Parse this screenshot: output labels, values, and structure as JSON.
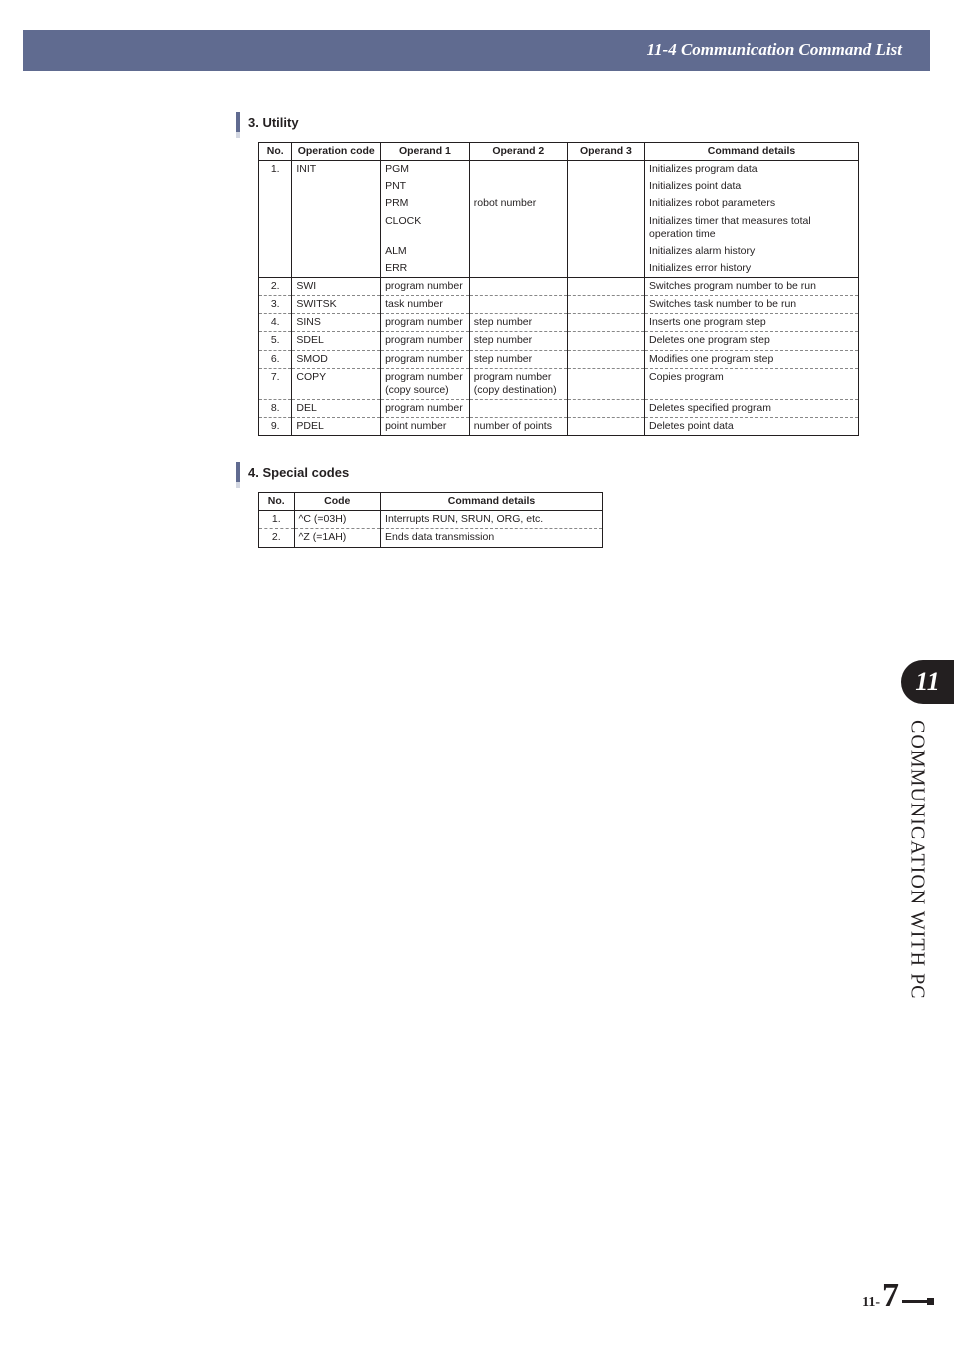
{
  "header": {
    "title": "11-4 Communication Command List"
  },
  "sections": [
    {
      "number": "3.",
      "title": "Utility",
      "table": {
        "headers": [
          "No.",
          "Operation code",
          "Operand 1",
          "Operand 2",
          "Operand 3",
          "Command details"
        ],
        "rows": [
          {
            "no": "1.",
            "op": "INIT",
            "o1": "PGM",
            "o2": "",
            "o3": "",
            "dt": "Initializes program data",
            "sep": "none"
          },
          {
            "no": "",
            "op": "",
            "o1": "PNT",
            "o2": "",
            "o3": "",
            "dt": "Initializes point data",
            "sep": "none"
          },
          {
            "no": "",
            "op": "",
            "o1": "PRM",
            "o2": "robot number",
            "o3": "",
            "dt": "Initializes robot parameters",
            "sep": "none"
          },
          {
            "no": "",
            "op": "",
            "o1": "CLOCK",
            "o2": "",
            "o3": "",
            "dt": "Initializes timer that measures total operation time",
            "sep": "none"
          },
          {
            "no": "",
            "op": "",
            "o1": "ALM",
            "o2": "",
            "o3": "",
            "dt": "Initializes alarm history",
            "sep": "none"
          },
          {
            "no": "",
            "op": "",
            "o1": "ERR",
            "o2": "",
            "o3": "",
            "dt": "Initializes error history",
            "sep": "solid"
          },
          {
            "no": "2.",
            "op": "SWI",
            "o1": "program number",
            "o2": "",
            "o3": "",
            "dt": "Switches program number to be run",
            "sep": "dashed"
          },
          {
            "no": "3.",
            "op": "SWITSK",
            "o1": "task number",
            "o2": "",
            "o3": "",
            "dt": "Switches task number to be run",
            "sep": "dashed"
          },
          {
            "no": "4.",
            "op": "SINS",
            "o1": "program number",
            "o2": "step number",
            "o3": "",
            "dt": "Inserts one program step",
            "sep": "dashed"
          },
          {
            "no": "5.",
            "op": "SDEL",
            "o1": "program number",
            "o2": "step number",
            "o3": "",
            "dt": "Deletes one program step",
            "sep": "dashed"
          },
          {
            "no": "6.",
            "op": "SMOD",
            "o1": "program number",
            "o2": "step number",
            "o3": "",
            "dt": "Modifies one program step",
            "sep": "dashed"
          },
          {
            "no": "7.",
            "op": "COPY",
            "o1": "program number (copy source)",
            "o2": "program number (copy destination)",
            "o3": "",
            "dt": "Copies program",
            "sep": "dashed"
          },
          {
            "no": "8.",
            "op": "DEL",
            "o1": "program number",
            "o2": "",
            "o3": "",
            "dt": "Deletes specified program",
            "sep": "dashed"
          },
          {
            "no": "9.",
            "op": "PDEL",
            "o1": "point number",
            "o2": "number of points",
            "o3": "",
            "dt": "Deletes point data",
            "sep": "solid"
          }
        ]
      }
    },
    {
      "number": "4.",
      "title": "Special codes",
      "table": {
        "headers": [
          "No.",
          "Code",
          "Command details"
        ],
        "rows": [
          {
            "no": "1.",
            "cd": "^C (=03H)",
            "dt": "Interrupts RUN, SRUN, ORG, etc.",
            "sep": "dashed"
          },
          {
            "no": "2.",
            "cd": "^Z (=1AH)",
            "dt": "Ends data transmission",
            "sep": "solid"
          }
        ]
      }
    }
  ],
  "sidebar": {
    "chapter": "11",
    "title": "COMMUNICATION WITH PC"
  },
  "footer": {
    "prefix": "11-",
    "page": "7"
  }
}
